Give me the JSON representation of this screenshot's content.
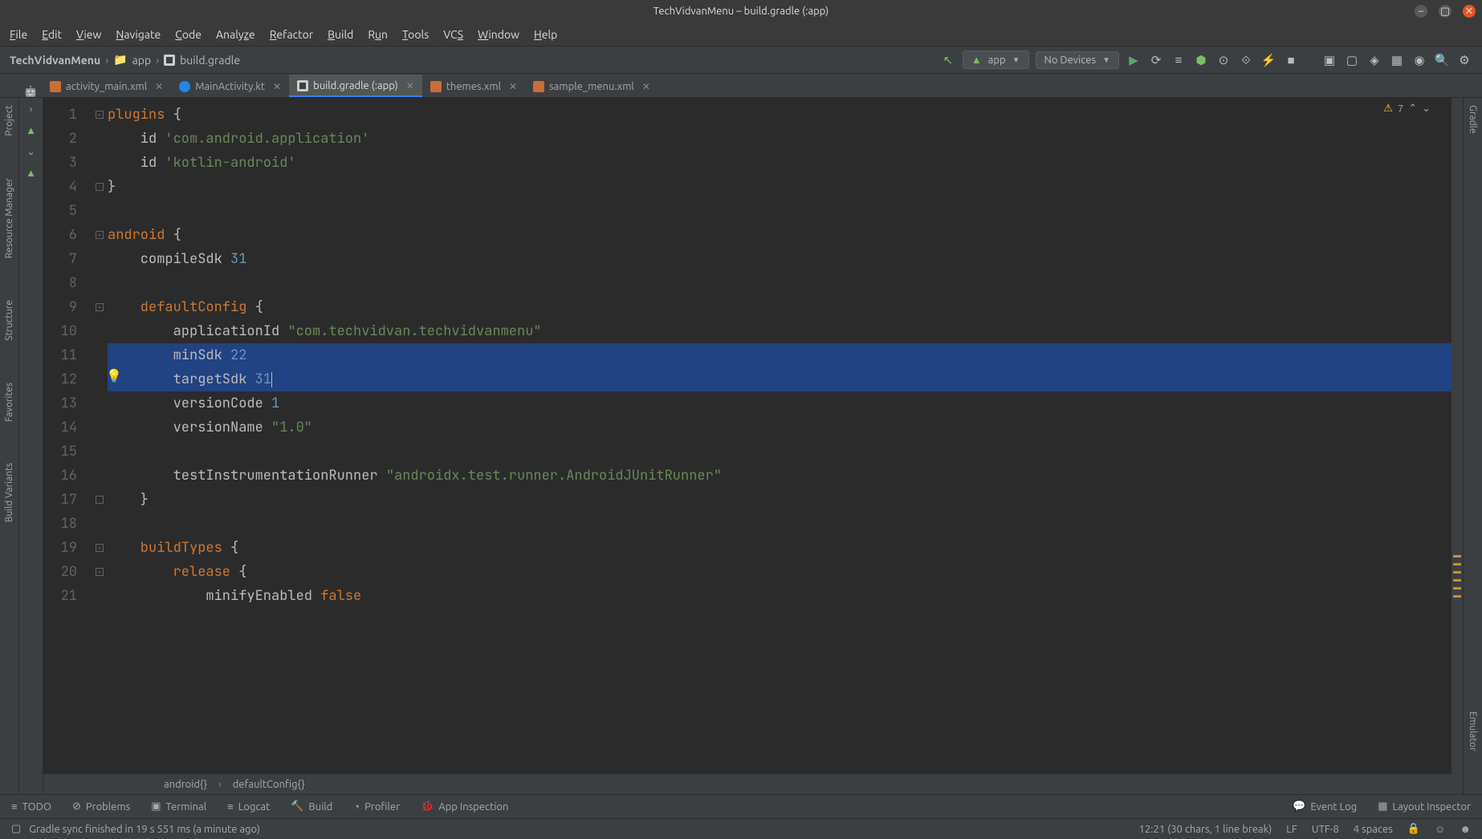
{
  "window": {
    "title": "TechVidvanMenu – build.gradle (:app)"
  },
  "menus": [
    "File",
    "Edit",
    "View",
    "Navigate",
    "Code",
    "Analyze",
    "Refactor",
    "Build",
    "Run",
    "Tools",
    "VCS",
    "Window",
    "Help"
  ],
  "breadcrumb": {
    "root": "TechVidvanMenu",
    "module": "app",
    "file": "build.gradle"
  },
  "run": {
    "config": "app",
    "device": "No Devices"
  },
  "tabs": [
    {
      "label": "activity_main.xml",
      "type": "xml",
      "active": false
    },
    {
      "label": "MainActivity.kt",
      "type": "kt",
      "active": false
    },
    {
      "label": "build.gradle (:app)",
      "type": "gradle",
      "active": true
    },
    {
      "label": "themes.xml",
      "type": "xml",
      "active": false
    },
    {
      "label": "sample_menu.xml",
      "type": "xml",
      "active": false
    }
  ],
  "leftRail": [
    "Project",
    "Resource Manager",
    "Structure",
    "Favorites",
    "Build Variants"
  ],
  "rightRail": [
    "Gradle",
    "Emulator"
  ],
  "inspection": {
    "warn_count": "7"
  },
  "code": {
    "lines": [
      {
        "n": "1",
        "seg": [
          {
            "t": "plugins ",
            "c": "kw"
          },
          {
            "t": "{"
          }
        ]
      },
      {
        "n": "2",
        "seg": [
          {
            "t": "    id ",
            "c": ""
          },
          {
            "t": "'com.android.application'",
            "c": "str"
          }
        ]
      },
      {
        "n": "3",
        "seg": [
          {
            "t": "    id ",
            "c": ""
          },
          {
            "t": "'kotlin-android'",
            "c": "str"
          }
        ]
      },
      {
        "n": "4",
        "seg": [
          {
            "t": "}"
          }
        ]
      },
      {
        "n": "5",
        "seg": [
          {
            "t": ""
          }
        ]
      },
      {
        "n": "6",
        "seg": [
          {
            "t": "android ",
            "c": "kw"
          },
          {
            "t": "{"
          }
        ]
      },
      {
        "n": "7",
        "seg": [
          {
            "t": "    compileSdk ",
            "c": ""
          },
          {
            "t": "31",
            "c": "num"
          }
        ]
      },
      {
        "n": "8",
        "seg": [
          {
            "t": ""
          }
        ]
      },
      {
        "n": "9",
        "seg": [
          {
            "t": "    defaultConfig ",
            "c": "kw"
          },
          {
            "t": "{"
          }
        ]
      },
      {
        "n": "10",
        "seg": [
          {
            "t": "        applicationId ",
            "c": ""
          },
          {
            "t": "\"com.techvidvan.techvidvanmenu\"",
            "c": "str"
          }
        ]
      },
      {
        "n": "11",
        "sel": true,
        "seg": [
          {
            "t": "        minSdk ",
            "c": ""
          },
          {
            "t": "22",
            "c": "num"
          }
        ]
      },
      {
        "n": "12",
        "sel": true,
        "caret": true,
        "seg": [
          {
            "t": "        targetSdk ",
            "c": ""
          },
          {
            "t": "31",
            "c": "num"
          }
        ]
      },
      {
        "n": "13",
        "seg": [
          {
            "t": "        versionCode ",
            "c": ""
          },
          {
            "t": "1",
            "c": "num"
          }
        ]
      },
      {
        "n": "14",
        "seg": [
          {
            "t": "        versionName ",
            "c": ""
          },
          {
            "t": "\"1.0\"",
            "c": "str"
          }
        ]
      },
      {
        "n": "15",
        "seg": [
          {
            "t": ""
          }
        ]
      },
      {
        "n": "16",
        "seg": [
          {
            "t": "        testInstrumentationRunner ",
            "c": ""
          },
          {
            "t": "\"androidx.test.runner.AndroidJUnitRunner\"",
            "c": "str"
          }
        ]
      },
      {
        "n": "17",
        "seg": [
          {
            "t": "    }"
          }
        ]
      },
      {
        "n": "18",
        "seg": [
          {
            "t": ""
          }
        ]
      },
      {
        "n": "19",
        "seg": [
          {
            "t": "    buildTypes ",
            "c": "kw"
          },
          {
            "t": "{"
          }
        ]
      },
      {
        "n": "20",
        "seg": [
          {
            "t": "        release ",
            "c": "kw"
          },
          {
            "t": "{"
          }
        ]
      },
      {
        "n": "21",
        "seg": [
          {
            "t": "            minifyEnabled ",
            "c": ""
          },
          {
            "t": "false",
            "c": "kw"
          }
        ]
      }
    ]
  },
  "breadcrumb_bottom": [
    "android{}",
    "defaultConfig{}"
  ],
  "bottombar": {
    "todo": "TODO",
    "problems": "Problems",
    "terminal": "Terminal",
    "logcat": "Logcat",
    "build": "Build",
    "profiler": "Profiler",
    "inspection": "App Inspection",
    "eventlog": "Event Log",
    "layoutinspector": "Layout Inspector"
  },
  "status": {
    "msg": "Gradle sync finished in 19 s 551 ms (a minute ago)",
    "pos": "12:21 (30 chars, 1 line break)",
    "lf": "LF",
    "enc": "UTF-8",
    "indent": "4 spaces"
  }
}
